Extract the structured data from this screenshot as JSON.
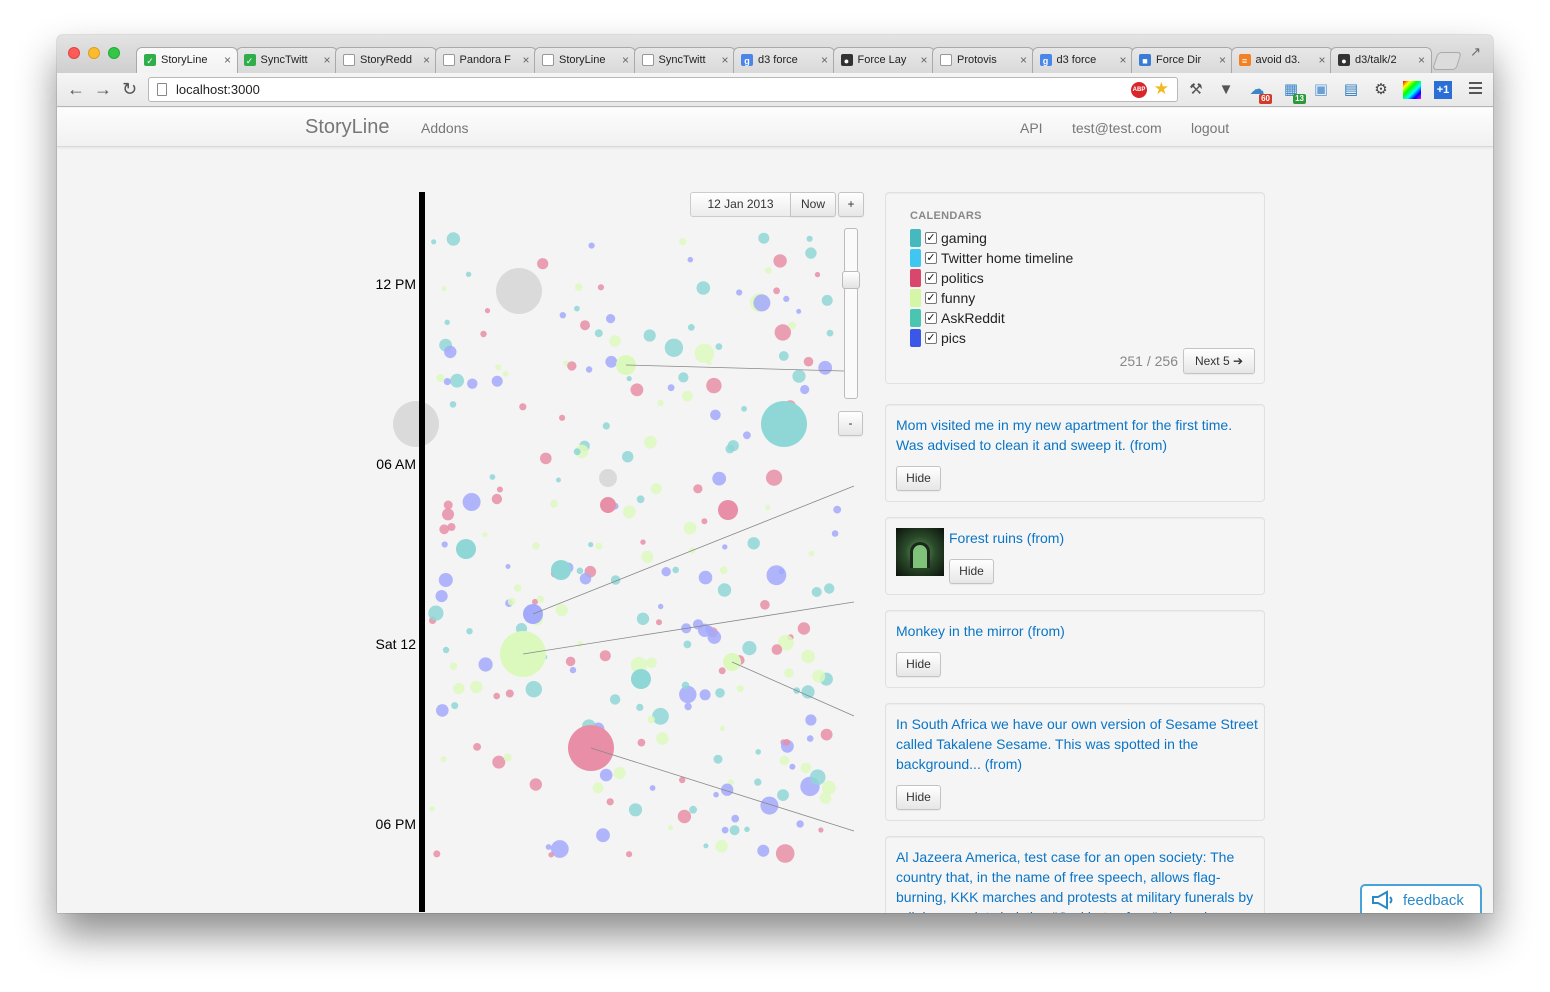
{
  "browser": {
    "tabs": [
      {
        "label": "StoryLine",
        "fav_color": "#2fae4b",
        "fav_glyph": "✓"
      },
      {
        "label": "SyncTwitt",
        "fav_color": "#2fae4b",
        "fav_glyph": "✓"
      },
      {
        "label": "StoryRedd",
        "fav_color": "#ffffff",
        "fav_glyph": ""
      },
      {
        "label": "Pandora F",
        "fav_color": "#ffffff",
        "fav_glyph": "P"
      },
      {
        "label": "StoryLine",
        "fav_color": "#ffffff",
        "fav_glyph": ""
      },
      {
        "label": "SyncTwitt",
        "fav_color": "#ffffff",
        "fav_glyph": ""
      },
      {
        "label": "d3 force",
        "fav_color": "#4a86e8",
        "fav_glyph": "g"
      },
      {
        "label": "Force Lay",
        "fav_color": "#333333",
        "fav_glyph": "●"
      },
      {
        "label": "Protovis",
        "fav_color": "#ffffff",
        "fav_glyph": ""
      },
      {
        "label": "d3 force",
        "fav_color": "#4a86e8",
        "fav_glyph": "g"
      },
      {
        "label": "Force Dir",
        "fav_color": "#3a7bd5",
        "fav_glyph": "■"
      },
      {
        "label": "avoid d3.",
        "fav_color": "#f48024",
        "fav_glyph": "≡"
      },
      {
        "label": "d3/talk/2",
        "fav_color": "#333333",
        "fav_glyph": "●"
      }
    ],
    "tab_close_glyph": "×",
    "url": "localhost:3000",
    "abp_label": "ABP",
    "extension_badges": [
      {
        "text": "60",
        "color": "#d23a2a"
      },
      {
        "text": "13",
        "color": "#2a9a3a"
      }
    ]
  },
  "app": {
    "brand": "StoryLine",
    "nav_left": [
      "Addons"
    ],
    "nav_right": [
      "API",
      "test@test.com",
      "logout"
    ]
  },
  "timeline": {
    "date_value": "12 Jan 2013",
    "now_label": "Now",
    "zoom_in_label": "+",
    "zoom_out_label": "-",
    "zoom_level": 0.28,
    "axis_labels": [
      "12 PM",
      "06 AM",
      "Sat 12",
      "06 PM"
    ]
  },
  "calendars": {
    "title": "CALENDARS",
    "items": [
      {
        "name": "gaming",
        "color": "#45b9be",
        "checked": true
      },
      {
        "name": "Twitter home timeline",
        "color": "#3fc7f1",
        "checked": true
      },
      {
        "name": "politics",
        "color": "#d9476d",
        "checked": true
      },
      {
        "name": "funny",
        "color": "#d4f6a6",
        "checked": true
      },
      {
        "name": "AskReddit",
        "color": "#4ac5b2",
        "checked": true
      },
      {
        "name": "pics",
        "color": "#3b57e8",
        "checked": true
      }
    ],
    "count_text": "251 / 256",
    "next_label": "Next 5 ➔"
  },
  "stories": [
    {
      "text": "Mom visited me in my new apartment for the first time. Was advised to clean it and sweep it. (from)",
      "hide_label": "Hide"
    },
    {
      "text": "Forest ruins (from)",
      "hide_label": "Hide"
    },
    {
      "text": "Monkey in the mirror (from)",
      "hide_label": "Hide"
    },
    {
      "text": "In South Africa we have our own version of Sesame Street called Takalene Sesame. This was spotted in the background... (from)",
      "hide_label": "Hide"
    },
    {
      "text": "Al Jazeera America, test case for an open society: The country that, in the name of free speech, allows flag-burning, KKK marches and protests at military funerals by religious zealots hoisting \"God hates fags\" placards decided that AJE represents the kind of speech it simply",
      "hide_label": ""
    }
  ],
  "feedback_label": "feedback",
  "colors": {
    "gaming": "#8fd6d6",
    "politics": "#e88ea6",
    "funny": "#dcf9bd",
    "pics": "#a3a9fb",
    "gray": "#dadada",
    "link": "#0b75c6"
  }
}
